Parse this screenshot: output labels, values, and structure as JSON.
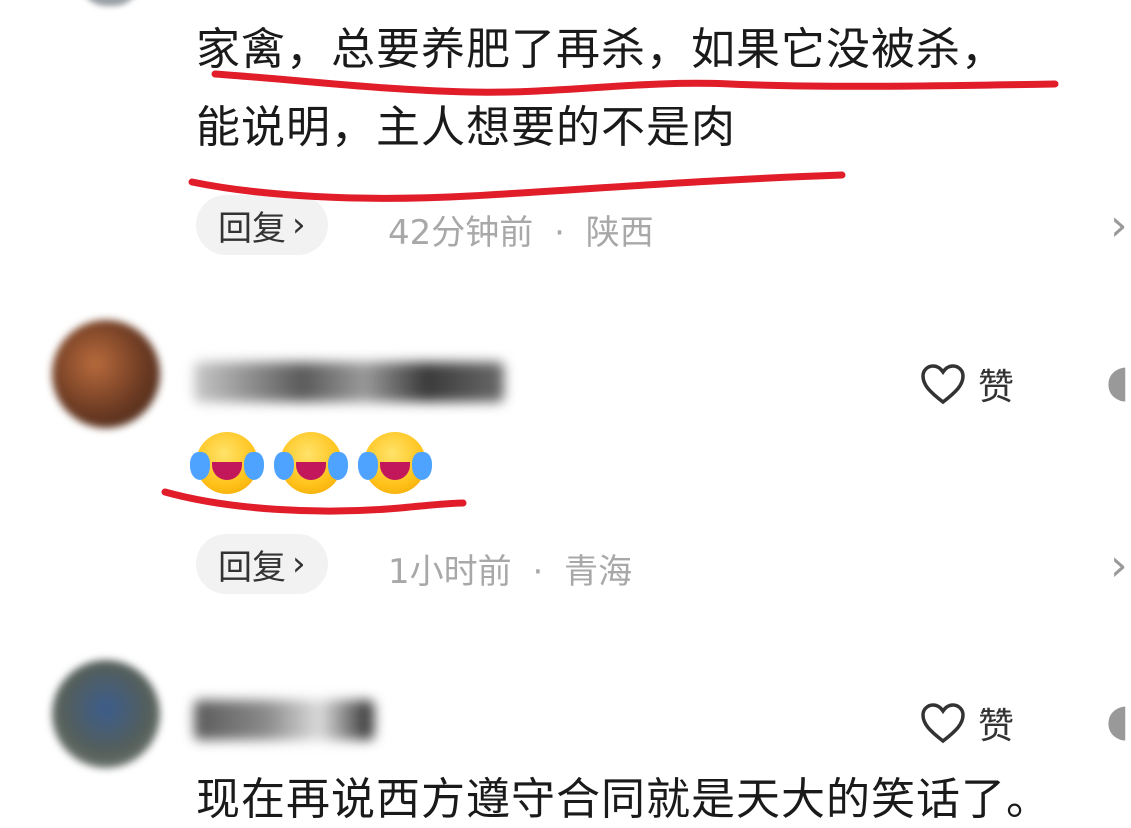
{
  "comment1": {
    "line1": "家禽，总要养肥了再杀，如果它没被杀，",
    "line2": "能说明，主人想要的不是肉",
    "reply_label": "回复",
    "time": "42分钟前",
    "location": "陕西"
  },
  "comment2": {
    "username": "",
    "emojis": [
      "rolling-laughing-emoji",
      "rolling-laughing-emoji",
      "rolling-laughing-emoji"
    ],
    "like_label": "赞",
    "reply_label": "回复",
    "time": "1小时前",
    "location": "青海"
  },
  "comment3": {
    "username": "",
    "like_label": "赞",
    "text": "现在再说西方遵守合同就是天大的笑话了。"
  },
  "separator": "·",
  "icons": {
    "like": "heart-outline-icon",
    "reply_chevron": "chevron-right-icon",
    "partial_right": "partial-icon"
  },
  "colors": {
    "annotation": "#e11d2a",
    "meta_text": "#a8a8a8",
    "reply_bg": "#f2f2f2"
  }
}
